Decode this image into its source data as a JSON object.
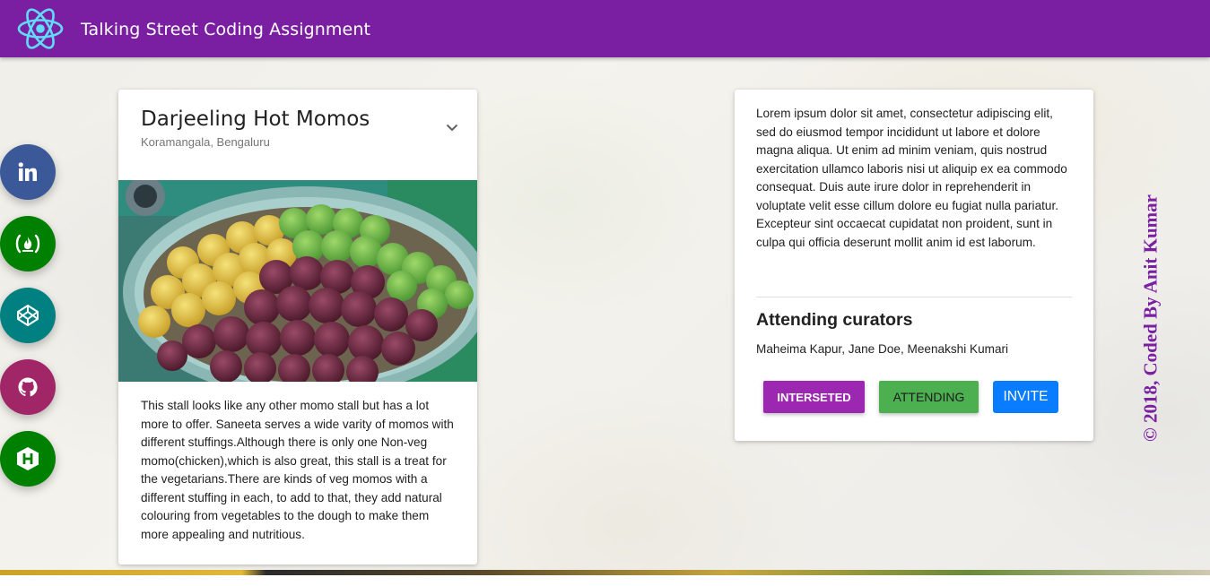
{
  "app": {
    "title": "Talking Street Coding Assignment",
    "logo_icon": "react-atom-icon"
  },
  "social_links": [
    {
      "name": "linkedin",
      "icon": "linkedin-icon",
      "color": "#3b5998"
    },
    {
      "name": "freecodecamp",
      "icon": "freecodecamp-icon",
      "color": "#008000"
    },
    {
      "name": "codepen",
      "icon": "codepen-icon",
      "color": "#008080"
    },
    {
      "name": "github",
      "icon": "github-icon",
      "color": "#a02668"
    },
    {
      "name": "hackerrank",
      "icon": "hackerrank-icon",
      "color": "#008000"
    }
  ],
  "stall": {
    "name": "Darjeeling Hot Momos",
    "location": "Koramangala, Bengaluru",
    "description": "This stall looks like any other momo stall but has a lot more to offer. Saneeta serves a wide varity of momos with different stuffings.Although there is only one Non-veg momo(chicken),which is also great, this stall is a treat for the vegetarians.There are kinds of veg momos with a different stuffing in each, to add to that, they add natural colouring from vegetables to the dough to make them more appealing and nutritious."
  },
  "details": {
    "lorem": "Lorem ipsum dolor sit amet, consectetur adipiscing elit, sed do eiusmod tempor incididunt ut labore et dolore magna aliqua. Ut enim ad minim veniam, quis nostrud exercitation ullamco laboris nisi ut aliquip ex ea commodo consequat. Duis aute irure dolor in reprehenderit in voluptate velit esse cillum dolore eu fugiat nulla pariatur. Excepteur sint occaecat cupidatat non proident, sunt in culpa qui officia deserunt mollit anim id est laborum.",
    "curators_heading": "Attending curators",
    "curators": "Maheima Kapur, Jane Doe, Meenakshi Kumari",
    "buttons": {
      "interested": "INTERSETED",
      "attending": "ATTENDING",
      "invite": "INVITE"
    }
  },
  "credit": "© 2018, Coded By Anit Kumar",
  "colors": {
    "navbar": "#7b1fa2",
    "interested": "#9c27b0",
    "attending": "#4caf50",
    "invite": "#0a7cff",
    "credit": "#7b1fa2"
  }
}
